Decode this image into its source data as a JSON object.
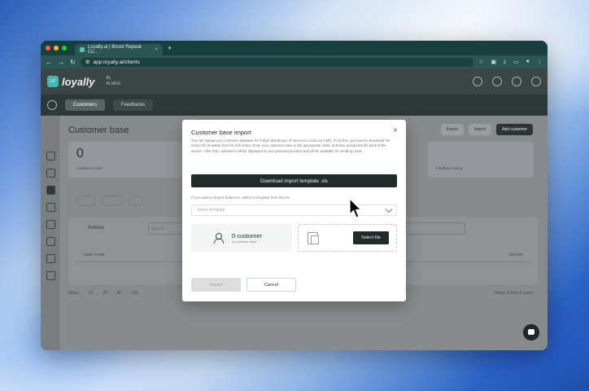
{
  "browser": {
    "tab_title": "Loyally.ai | Boost Repeat Cu…",
    "url": "app.loyally.ai/clients",
    "new_tab": "+"
  },
  "app": {
    "logo_text": "loyally",
    "logo_badge": "LO",
    "org_label": "BL",
    "org_name": "ALIAGE",
    "subnav": {
      "customers": "Customers",
      "feedbacks": "Feedbacks"
    },
    "page_title": "Customer base",
    "actions": {
      "export": "Export",
      "import": "Import",
      "add": "Add customer"
    },
    "stat": {
      "value": "0",
      "label": "Customers total"
    },
    "stat2_label": "Feedback rating",
    "table": {
      "actions_label": "Actions",
      "search_placeholder": "Search",
      "headers": [
        "USER NAME",
        "",
        "LTH",
        "DEVICE"
      ]
    },
    "pager": {
      "label": "Show",
      "sizes": [
        "10",
        "20",
        "50",
        "100"
      ],
      "range": "Shown 0 from 0 users"
    }
  },
  "modal": {
    "title": "Customer base import",
    "close": "×",
    "description": "You can upload your customer database for further distribution of electronic cards via CMS. To do this, you need to download the import file template from the link below. Enter your customer base in the appropriate fields, and then upload the file back to the service. After that, customers will be displayed in your personal account and will be available for sending cards.",
    "download_label": "Download import template .xls",
    "hint": "If you want to import balances, select a template from the list",
    "select_placeholder": "Select template",
    "count_value": "0 customer",
    "count_sub": "in customer base",
    "select_file": "Select file",
    "import_label": "Import",
    "cancel_label": "Cancel"
  },
  "colors": {
    "accent": "#42b6b0",
    "dark_button": "#212b2b",
    "overlay": "#7d7f81"
  }
}
